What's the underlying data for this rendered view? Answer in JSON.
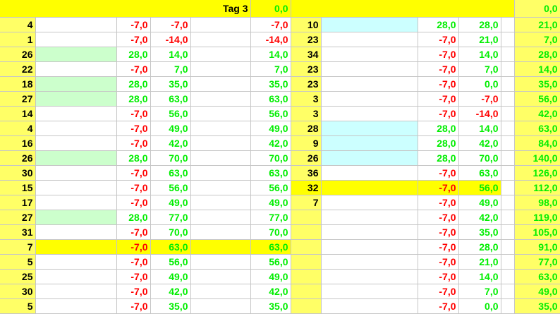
{
  "header": {
    "label": "Tag 3",
    "left_total": "0,0",
    "right_total": "0,0"
  },
  "colors": {
    "column_yellow": "#ffff66",
    "row_highlight": "#ffff00",
    "mint": "#ccffcc",
    "cyan": "#ccffff",
    "negative": "#ff0000",
    "positive": "#00ee00"
  },
  "rows": [
    {
      "n": "4",
      "a": "",
      "b": "-7,0",
      "c": "-7,0",
      "d": "",
      "e": "-7,0",
      "f": "10",
      "g": "",
      "h": "28,0",
      "i": "28,0",
      "j": "",
      "k": "21,0"
    },
    {
      "n": "1",
      "a": "",
      "b": "-7,0",
      "c": "-14,0",
      "d": "",
      "e": "-14,0",
      "f": "23",
      "g": "",
      "h": "-7,0",
      "i": "21,0",
      "j": "",
      "k": "7,0"
    },
    {
      "n": "26",
      "a": "",
      "b": "28,0",
      "c": "14,0",
      "d": "",
      "e": "14,0",
      "f": "34",
      "g": "",
      "h": "-7,0",
      "i": "14,0",
      "j": "",
      "k": "28,0"
    },
    {
      "n": "22",
      "a": "",
      "b": "-7,0",
      "c": "7,0",
      "d": "",
      "e": "7,0",
      "f": "23",
      "g": "",
      "h": "-7,0",
      "i": "7,0",
      "j": "",
      "k": "14,0"
    },
    {
      "n": "18",
      "a": "",
      "b": "28,0",
      "c": "35,0",
      "d": "",
      "e": "35,0",
      "f": "23",
      "g": "",
      "h": "-7,0",
      "i": "0,0",
      "j": "",
      "k": "35,0"
    },
    {
      "n": "27",
      "a": "",
      "b": "28,0",
      "c": "63,0",
      "d": "",
      "e": "63,0",
      "f": "3",
      "g": "",
      "h": "-7,0",
      "i": "-7,0",
      "j": "",
      "k": "56,0"
    },
    {
      "n": "14",
      "a": "",
      "b": "-7,0",
      "c": "56,0",
      "d": "",
      "e": "56,0",
      "f": "3",
      "g": "",
      "h": "-7,0",
      "i": "-14,0",
      "j": "",
      "k": "42,0"
    },
    {
      "n": "4",
      "a": "",
      "b": "-7,0",
      "c": "49,0",
      "d": "",
      "e": "49,0",
      "f": "28",
      "g": "",
      "h": "28,0",
      "i": "14,0",
      "j": "",
      "k": "63,0"
    },
    {
      "n": "16",
      "a": "",
      "b": "-7,0",
      "c": "42,0",
      "d": "",
      "e": "42,0",
      "f": "9",
      "g": "",
      "h": "28,0",
      "i": "42,0",
      "j": "",
      "k": "84,0"
    },
    {
      "n": "26",
      "a": "",
      "b": "28,0",
      "c": "70,0",
      "d": "",
      "e": "70,0",
      "f": "26",
      "g": "",
      "h": "28,0",
      "i": "70,0",
      "j": "",
      "k": "140,0"
    },
    {
      "n": "30",
      "a": "",
      "b": "-7,0",
      "c": "63,0",
      "d": "",
      "e": "63,0",
      "f": "36",
      "g": "",
      "h": "-7,0",
      "i": "63,0",
      "j": "",
      "k": "126,0"
    },
    {
      "n": "15",
      "a": "",
      "b": "-7,0",
      "c": "56,0",
      "d": "",
      "e": "56,0",
      "f": "32",
      "g": "",
      "h": "-7,0",
      "i": "56,0",
      "j": "",
      "k": "112,0"
    },
    {
      "n": "17",
      "a": "",
      "b": "-7,0",
      "c": "49,0",
      "d": "",
      "e": "49,0",
      "f": "7",
      "g": "",
      "h": "-7,0",
      "i": "49,0",
      "j": "",
      "k": "98,0"
    },
    {
      "n": "27",
      "a": "",
      "b": "28,0",
      "c": "77,0",
      "d": "",
      "e": "77,0",
      "f": "",
      "g": "",
      "h": "-7,0",
      "i": "42,0",
      "j": "",
      "k": "119,0"
    },
    {
      "n": "31",
      "a": "",
      "b": "-7,0",
      "c": "70,0",
      "d": "",
      "e": "70,0",
      "f": "",
      "g": "",
      "h": "-7,0",
      "i": "35,0",
      "j": "",
      "k": "105,0"
    },
    {
      "n": "7",
      "a": "",
      "b": "-7,0",
      "c": "63,0",
      "d": "",
      "e": "63,0",
      "f": "",
      "g": "",
      "h": "-7,0",
      "i": "28,0",
      "j": "",
      "k": "91,0"
    },
    {
      "n": "5",
      "a": "",
      "b": "-7,0",
      "c": "56,0",
      "d": "",
      "e": "56,0",
      "f": "",
      "g": "",
      "h": "-7,0",
      "i": "21,0",
      "j": "",
      "k": "77,0"
    },
    {
      "n": "25",
      "a": "",
      "b": "-7,0",
      "c": "49,0",
      "d": "",
      "e": "49,0",
      "f": "",
      "g": "",
      "h": "-7,0",
      "i": "14,0",
      "j": "",
      "k": "63,0"
    },
    {
      "n": "30",
      "a": "",
      "b": "-7,0",
      "c": "42,0",
      "d": "",
      "e": "42,0",
      "f": "",
      "g": "",
      "h": "-7,0",
      "i": "7,0",
      "j": "",
      "k": "49,0"
    },
    {
      "n": "5",
      "a": "",
      "b": "-7,0",
      "c": "35,0",
      "d": "",
      "e": "35,0",
      "f": "",
      "g": "",
      "h": "-7,0",
      "i": "0,0",
      "j": "",
      "k": "35,0"
    }
  ]
}
